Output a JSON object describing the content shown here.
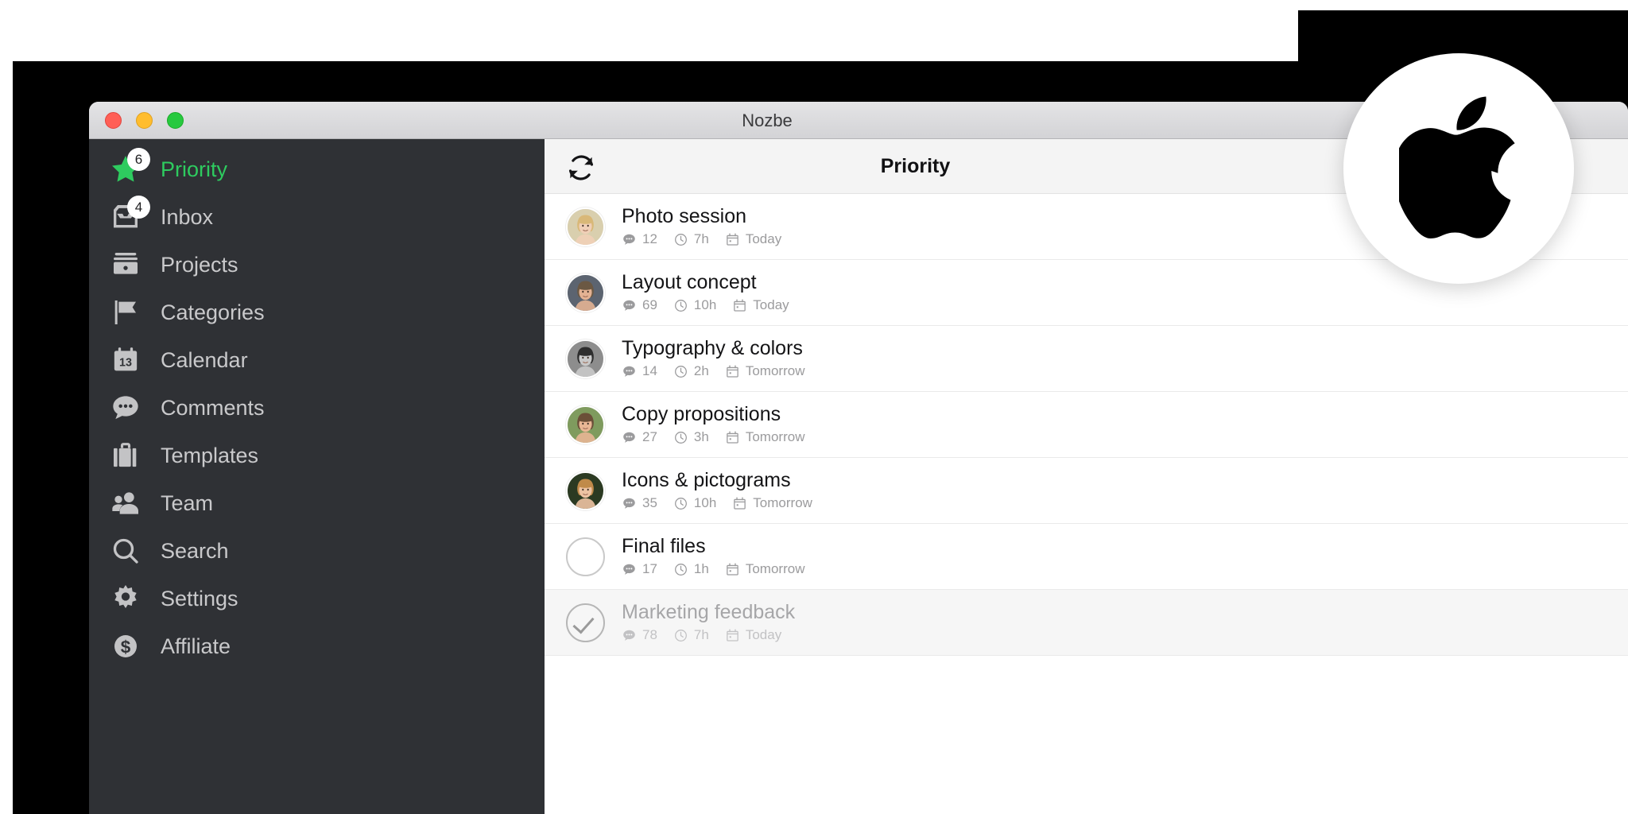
{
  "window": {
    "title": "Nozbe",
    "traffic_lights": [
      {
        "name": "close",
        "color": "#ff5f56"
      },
      {
        "name": "minimize",
        "color": "#ffbd2e"
      },
      {
        "name": "zoom",
        "color": "#27c93f"
      }
    ]
  },
  "overlay": {
    "logo": "apple-logo",
    "background": "#ffffff"
  },
  "sidebar": {
    "accent_color": "#2ecb5f",
    "background": "#2f3135",
    "items": [
      {
        "label": "Priority",
        "icon": "star-icon",
        "badge": "6",
        "active": true
      },
      {
        "label": "Inbox",
        "icon": "inbox-icon",
        "badge": "4",
        "active": false
      },
      {
        "label": "Projects",
        "icon": "projects-icon",
        "badge": null,
        "active": false
      },
      {
        "label": "Categories",
        "icon": "flag-icon",
        "badge": null,
        "active": false
      },
      {
        "label": "Calendar",
        "icon": "calendar-icon",
        "badge": null,
        "active": false
      },
      {
        "label": "Comments",
        "icon": "comment-icon",
        "badge": null,
        "active": false
      },
      {
        "label": "Templates",
        "icon": "briefcase-icon",
        "badge": null,
        "active": false
      },
      {
        "label": "Team",
        "icon": "people-icon",
        "badge": null,
        "active": false
      },
      {
        "label": "Search",
        "icon": "search-icon",
        "badge": null,
        "active": false
      },
      {
        "label": "Settings",
        "icon": "gear-icon",
        "badge": null,
        "active": false
      },
      {
        "label": "Affiliate",
        "icon": "dollar-icon",
        "badge": null,
        "active": false
      }
    ]
  },
  "main": {
    "header": {
      "title": "Priority",
      "refresh_icon": "refresh-icon"
    },
    "calendar_icon_day": "13",
    "tasks": [
      {
        "title": "Photo session",
        "comments": "12",
        "time": "7h",
        "due": "Today",
        "state": "avatar",
        "avatar": "woman-blonde"
      },
      {
        "title": "Layout concept",
        "comments": "69",
        "time": "10h",
        "due": "Today",
        "state": "avatar",
        "avatar": "man-short-hair"
      },
      {
        "title": "Typography & colors",
        "comments": "14",
        "time": "2h",
        "due": "Tomorrow",
        "state": "avatar",
        "avatar": "man-beard"
      },
      {
        "title": "Copy propositions",
        "comments": "27",
        "time": "3h",
        "due": "Tomorrow",
        "state": "avatar",
        "avatar": "man-smiling"
      },
      {
        "title": "Icons & pictograms",
        "comments": "35",
        "time": "10h",
        "due": "Tomorrow",
        "state": "avatar",
        "avatar": "woman-red-hair"
      },
      {
        "title": "Final files",
        "comments": "17",
        "time": "1h",
        "due": "Tomorrow",
        "state": "unchecked",
        "avatar": null
      },
      {
        "title": "Marketing feedback",
        "comments": "78",
        "time": "7h",
        "due": "Today",
        "state": "checked",
        "avatar": null
      }
    ]
  }
}
